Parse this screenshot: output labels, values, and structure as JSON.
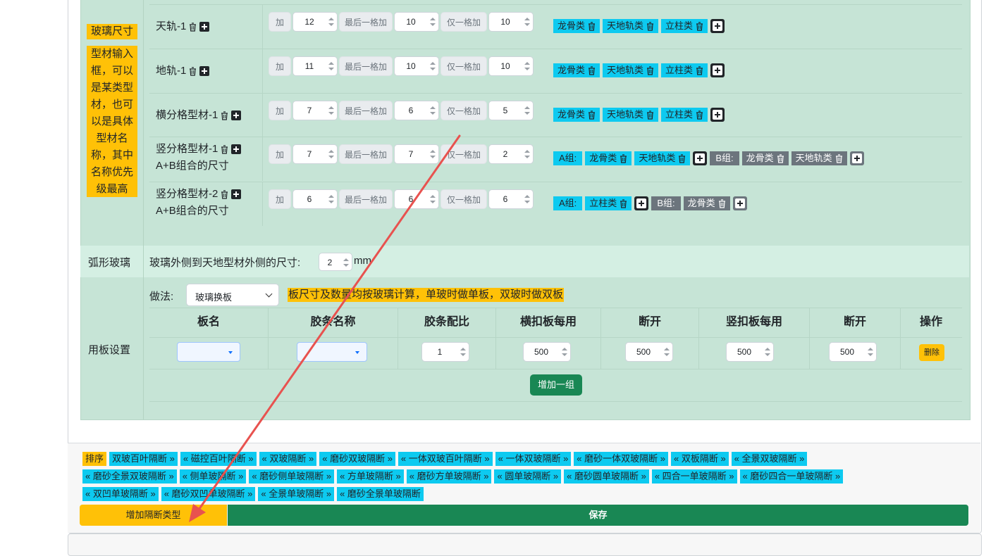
{
  "glass_size_label": "玻璃尺寸",
  "glass_desc": "型材输入框，可以是某类型材，也可以是具体型材名称，其中名称优先级最高",
  "rows": [
    {
      "name": "天轨-1",
      "sub": "",
      "add": "加",
      "add_val": "12",
      "last_label": "最后一格加",
      "last_val": "10",
      "only_label": "仅一格加",
      "only_val": "10",
      "tags": [
        "龙骨类",
        "天地轨类",
        "立柱类"
      ]
    },
    {
      "name": "地轨-1",
      "sub": "",
      "add": "加",
      "add_val": "11",
      "last_label": "最后一格加",
      "last_val": "10",
      "only_label": "仅一格加",
      "only_val": "10",
      "tags": [
        "龙骨类",
        "天地轨类",
        "立柱类"
      ]
    },
    {
      "name": "横分格型材-1",
      "sub": "",
      "add": "加",
      "add_val": "7",
      "last_label": "最后一格加",
      "last_val": "6",
      "only_label": "仅一格加",
      "only_val": "5",
      "tags": [
        "龙骨类",
        "天地轨类",
        "立柱类"
      ]
    },
    {
      "name": "竖分格型材-1",
      "sub": "A+B组合的尺寸",
      "add": "加",
      "add_val": "7",
      "last_label": "最后一格加",
      "last_val": "7",
      "only_label": "仅一格加",
      "only_val": "2",
      "a_label": "A组:",
      "a_tags": [
        "龙骨类",
        "天地轨类"
      ],
      "b_label": "B组:",
      "b_tags": [
        "龙骨类",
        "天地轨类"
      ]
    },
    {
      "name": "竖分格型材-2",
      "sub": "A+B组合的尺寸",
      "add": "加",
      "add_val": "6",
      "last_label": "最后一格加",
      "last_val": "6",
      "only_label": "仅一格加",
      "only_val": "6",
      "a_label": "A组:",
      "a_tags": [
        "立柱类"
      ],
      "b_label": "B组:",
      "b_tags": [
        "龙骨类"
      ]
    }
  ],
  "arc": {
    "label": "弧形玻璃",
    "text": "玻璃外侧到天地型材外侧的尺寸:",
    "value": "2",
    "unit": "mm"
  },
  "board": {
    "label": "用板设置",
    "method_label": "做法:",
    "method_value": "玻璃换板",
    "note": "板尺寸及数量均按玻璃计算，单玻时做单板，双玻时做双板",
    "headers": [
      "板名",
      "胶条名称",
      "胶条配比",
      "横扣板每用",
      "断开",
      "竖扣板每用",
      "断开",
      "操作"
    ],
    "row": {
      "ratio": "1",
      "h_use": "500",
      "h_break": "500",
      "v_use": "500",
      "v_break": "500",
      "delete": "删除"
    },
    "add_group": "增加一组"
  },
  "sort": {
    "label": "排序",
    "lines": [
      [
        "双玻百叶隔断 »",
        "« 磁控百叶隔断 »",
        "« 双玻隔断 »",
        "« 磨砂双玻隔断 »",
        "« 一体双玻百叶隔断 »",
        "« 一体双玻隔断 »",
        "« 磨砂一体双玻隔断 »",
        "« 双板隔断 »",
        "« 全景双玻隔断 »"
      ],
      [
        "« 磨砂全景双玻隔断 »",
        "« 侧单玻隔断 »",
        "« 磨砂侧单玻隔断 »",
        "« 方单玻隔断 »",
        "« 磨砂方单玻隔断 »",
        "« 圆单玻隔断 »",
        "« 磨砂圆单玻隔断 »",
        "« 四合一单玻隔断 »",
        "« 磨砂四合一单玻隔断 »"
      ],
      [
        "« 双凹单玻隔断 »",
        "« 磨砂双凹单玻隔断 »",
        "« 全景单玻隔断 »",
        "« 磨砂全景单玻隔断"
      ]
    ]
  },
  "buttons": {
    "add_type": "增加隔断类型",
    "save": "保存"
  },
  "colors": {
    "accent_green": "#198754",
    "yellow": "#ffc107",
    "cyan": "#0dcaf0",
    "gray": "#6c757d",
    "annotation_red": "#e8524f"
  }
}
